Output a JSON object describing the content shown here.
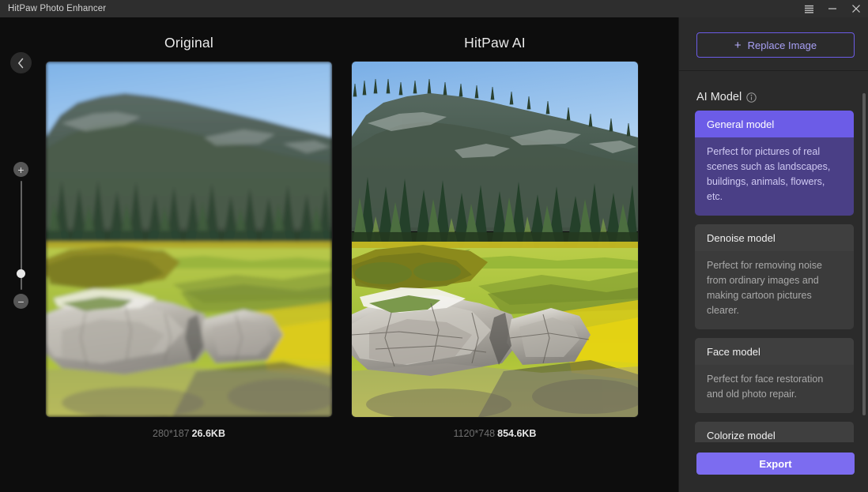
{
  "window": {
    "title": "HitPaw Photo Enhancer",
    "controls": [
      {
        "name": "menu-button",
        "icon": "hamburger-icon"
      },
      {
        "name": "minimize-button",
        "icon": "minimize-icon"
      },
      {
        "name": "close-button",
        "icon": "close-icon"
      }
    ]
  },
  "workspace": {
    "back_button_icon": "chevron-left-icon",
    "zoom": {
      "zoom_in_label": "+",
      "zoom_out_label": "−"
    },
    "panes": [
      {
        "title": "Original",
        "dimensions": "280*187",
        "filesize": "26.6KB"
      },
      {
        "title": "HitPaw AI",
        "dimensions": "1120*748",
        "filesize": "854.6KB"
      }
    ]
  },
  "sidebar": {
    "replace_image_label": "Replace Image",
    "replace_image_plus": "+",
    "section_title": "AI Model",
    "info_icon": "info-icon",
    "models": [
      {
        "name": "General model",
        "description": "Perfect for pictures of real scenes such as landscapes, buildings, animals, flowers, etc.",
        "selected": true
      },
      {
        "name": "Denoise model",
        "description": "Perfect for removing noise from ordinary images and making cartoon pictures clearer.",
        "selected": false
      },
      {
        "name": "Face model",
        "description": "Perfect for face restoration and old photo repair.",
        "selected": false
      },
      {
        "name": "Colorize model",
        "description": "",
        "selected": false
      }
    ],
    "export_label": "Export"
  },
  "colors": {
    "accent": "#6c5ce7",
    "accent_button": "#7c6cf0",
    "panel_bg": "#2b2b2b",
    "titlebar_bg": "#2e2e2e",
    "workspace_bg": "#0d0d0d"
  }
}
